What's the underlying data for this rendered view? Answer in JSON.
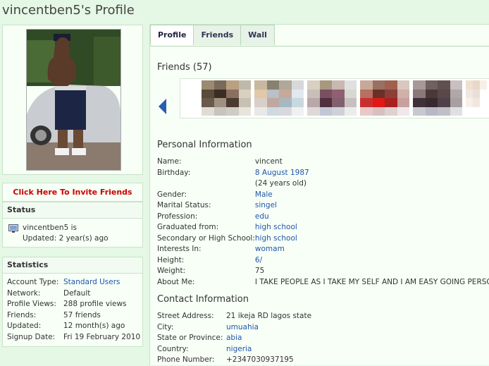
{
  "profile_title": "vincentben5's Profile",
  "invite_label": "Click Here To Invite Friends",
  "status": {
    "heading": "Status",
    "line1": "vincentben5 is",
    "line2": "Updated: 2 year(s) ago"
  },
  "statistics": {
    "heading": "Statistics",
    "rows": [
      {
        "key": "Account Type:",
        "value": "Standard Users",
        "link": true
      },
      {
        "key": "Network:",
        "value": "Default",
        "link": false
      },
      {
        "key": "Profile Views:",
        "value": "288 profile views",
        "link": false
      },
      {
        "key": "Friends:",
        "value": "57 friends",
        "link": false
      },
      {
        "key": "Updated:",
        "value": "12 month(s) ago",
        "link": false
      },
      {
        "key": "Signup Date:",
        "value": "Fri 19 February 2010",
        "link": false
      }
    ]
  },
  "tabs": [
    "Profile",
    "Friends",
    "Wall"
  ],
  "friends_heading": "Friends (57)",
  "personal": {
    "heading": "Personal Information",
    "rows": [
      {
        "key": "Name:",
        "value": "vincent",
        "link": false
      },
      {
        "key": "Birthday:",
        "value": "8 August 1987",
        "link": true
      },
      {
        "key": "",
        "value": "(24 years old)",
        "link": false
      },
      {
        "key": "Gender:",
        "value": "Male",
        "link": true
      },
      {
        "key": "Marital Status:",
        "value": "singel",
        "link": true
      },
      {
        "key": "Profession:",
        "value": "edu",
        "link": true
      },
      {
        "key": "Graduated from:",
        "value": "high school",
        "link": true
      },
      {
        "key": "Secondary or High School:",
        "value": "high school",
        "link": true
      },
      {
        "key": "Interests In:",
        "value": "womam",
        "link": true
      },
      {
        "key": "Height:",
        "value": "6/",
        "link": true
      },
      {
        "key": "Weight:",
        "value": "75",
        "link": false
      },
      {
        "key": "About Me:",
        "value": "I TAKE PEOPLE AS I TAKE MY SELF AND I AM EASY GOING PERSON",
        "link": false
      }
    ]
  },
  "contact": {
    "heading": "Contact Information",
    "rows": [
      {
        "key": "Street Address:",
        "value": "21 ikeja RD lagos state",
        "link": false
      },
      {
        "key": "City:",
        "value": "umuahia",
        "link": true
      },
      {
        "key": "State or Province:",
        "value": "abia",
        "link": true
      },
      {
        "key": "Country:",
        "value": "nigeria",
        "link": true
      },
      {
        "key": "Phone Number:",
        "value": "+2347030937195",
        "link": false
      }
    ]
  },
  "colors": {
    "background": "#e5f7e5",
    "link": "#2255aa",
    "invite": "#cc0000",
    "arrow": "#2a5db0"
  },
  "icons": [
    "monitor-icon",
    "arrow-left-icon"
  ]
}
